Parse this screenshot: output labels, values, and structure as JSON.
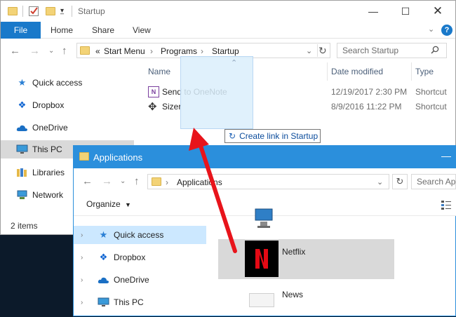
{
  "win1": {
    "title": "Startup",
    "ribbon_tabs": [
      "File",
      "Home",
      "Share",
      "View"
    ],
    "help": "?",
    "breadcrumb_prefix": "«",
    "breadcrumb": [
      "Start Menu",
      "Programs",
      "Startup"
    ],
    "search_placeholder": "Search Startup",
    "nav_items": [
      {
        "label": "Quick access",
        "icon": "star-icon"
      },
      {
        "label": "Dropbox",
        "icon": "dropbox-icon"
      },
      {
        "label": "OneDrive",
        "icon": "onedrive-icon"
      },
      {
        "label": "This PC",
        "icon": "monitor-icon"
      },
      {
        "label": "Libraries",
        "icon": "libraries-icon"
      },
      {
        "label": "Network",
        "icon": "network-icon"
      }
    ],
    "columns": {
      "name": "Name",
      "date": "Date modified",
      "type": "Type"
    },
    "files": [
      {
        "name": "Send to OneNote",
        "date": "12/19/2017 2:30 PM",
        "type": "Shortcut"
      },
      {
        "name": "Sizer",
        "date": "8/9/2016 11:22 PM",
        "type": "Shortcut"
      }
    ],
    "status": "2 items",
    "drag_tip": "Create link in Startup"
  },
  "win2": {
    "title": "Applications",
    "breadcrumb": [
      "Applications"
    ],
    "search_placeholder": "Search Applications",
    "organize": "Organize",
    "nav_items": [
      {
        "label": "Quick access",
        "icon": "star-icon"
      },
      {
        "label": "Dropbox",
        "icon": "dropbox-icon"
      },
      {
        "label": "OneDrive",
        "icon": "onedrive-icon"
      },
      {
        "label": "This PC",
        "icon": "monitor-icon"
      }
    ],
    "apps": [
      {
        "label": "Netflix",
        "icon": "netflix-icon"
      },
      {
        "label": "News",
        "icon": "news-icon"
      }
    ]
  },
  "colors": {
    "accent": "#1979ca",
    "titlebar_active": "#2b8fdc",
    "arrow": "#e8141b",
    "netflix_red": "#e50914"
  }
}
